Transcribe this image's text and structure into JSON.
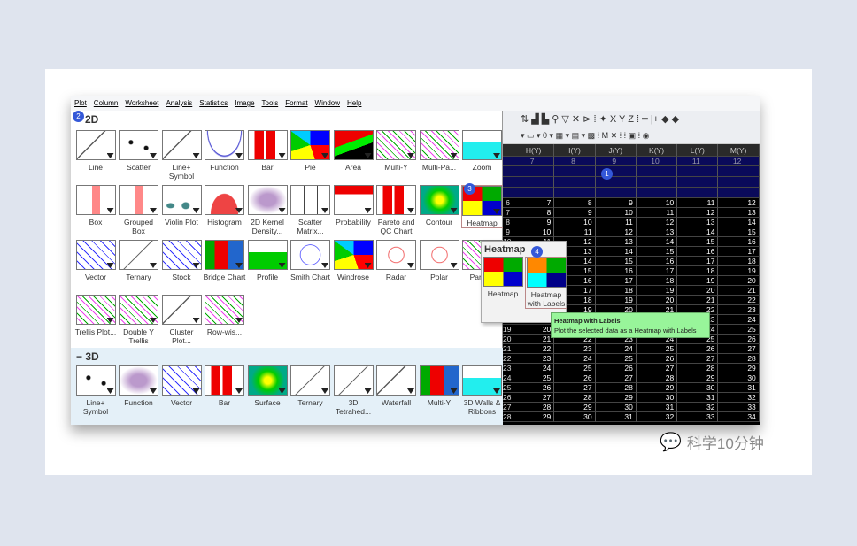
{
  "menubar": [
    "Plot",
    "Column",
    "Worksheet",
    "Analysis",
    "Statistics",
    "Image",
    "Tools",
    "Format",
    "Window",
    "Help"
  ],
  "section_2d": "2D",
  "section_3d": "− 3D",
  "rows2d": [
    [
      {
        "label": "Line",
        "icon": "line"
      },
      {
        "label": "Scatter",
        "icon": "scatter"
      },
      {
        "label": "Line+ Symbol",
        "icon": "line"
      },
      {
        "label": "Function",
        "icon": "function"
      },
      {
        "label": "Bar",
        "icon": "bar"
      },
      {
        "label": "Pie",
        "icon": "pie"
      },
      {
        "label": "Area",
        "icon": "area"
      },
      {
        "label": "Multi-Y",
        "icon": "multi"
      },
      {
        "label": "Multi-Pa...",
        "icon": "multi"
      },
      {
        "label": "Zoom",
        "icon": "zoom"
      }
    ],
    [
      {
        "label": "Box",
        "icon": "box"
      },
      {
        "label": "Grouped Box",
        "icon": "box"
      },
      {
        "label": "Violin Plot",
        "icon": "violin"
      },
      {
        "label": "Histogram",
        "icon": "hist"
      },
      {
        "label": "2D Kernel Density...",
        "icon": "kernel"
      },
      {
        "label": "Scatter Matrix...",
        "icon": "matrix"
      },
      {
        "label": "Probability",
        "icon": "prob"
      },
      {
        "label": "Pareto and QC Chart",
        "icon": "bar"
      },
      {
        "label": "Contour",
        "icon": "contour"
      },
      {
        "label": "Heatmap",
        "icon": "heatmap"
      }
    ],
    [
      {
        "label": "Vector",
        "icon": "vector"
      },
      {
        "label": "Ternary",
        "icon": "ternary"
      },
      {
        "label": "Stock",
        "icon": "vector"
      },
      {
        "label": "Bridge Chart",
        "icon": "bridge"
      },
      {
        "label": "Profile",
        "icon": "profile"
      },
      {
        "label": "Smith Chart",
        "icon": "smith"
      },
      {
        "label": "Windrose",
        "icon": "pie"
      },
      {
        "label": "Radar",
        "icon": "radar"
      },
      {
        "label": "Polar",
        "icon": "radar"
      },
      {
        "label": "Para Pl",
        "icon": "multi"
      }
    ],
    [
      {
        "label": "Trellis Plot...",
        "icon": "multi"
      },
      {
        "label": "Double Y Trellis",
        "icon": "multi"
      },
      {
        "label": "Cluster Plot...",
        "icon": "line"
      },
      {
        "label": "Row-wis...",
        "icon": "multi"
      }
    ]
  ],
  "row3d": [
    {
      "label": "Line+ Symbol",
      "icon": "scatter"
    },
    {
      "label": "Function",
      "icon": "kernel"
    },
    {
      "label": "Vector",
      "icon": "vector"
    },
    {
      "label": "Bar",
      "icon": "bar"
    },
    {
      "label": "Surface",
      "icon": "contour"
    },
    {
      "label": "Ternary",
      "icon": "ternary"
    },
    {
      "label": "3D Tetrahed...",
      "icon": "ternary"
    },
    {
      "label": "Waterfall",
      "icon": "line"
    },
    {
      "label": "Multi-Y",
      "icon": "bridge"
    },
    {
      "label": "3D Walls & Ribbons",
      "icon": "zoom"
    }
  ],
  "toolbar1": "⇅ ▟ ▙ ⚲ ▽ ✕ ⊳ ⁞ ✦ X Y Z ⁞ ━ |+ ◆ ◆",
  "toolbar2": "▾ ▭ ▾ 0 ▾ ▦ ▾ ▤ ▾ ▩ ⁞ M ✕ ⁞ ⁞ ▣ ⁞ ◉",
  "grid": {
    "columns": [
      "H(Y)",
      "I(Y)",
      "J(Y)",
      "K(Y)",
      "L(Y)",
      "M(Y)"
    ],
    "header_values": [
      "7",
      "8",
      "9",
      "10",
      "11",
      "12"
    ],
    "rows": [
      [
        6,
        7,
        8,
        9,
        10,
        11,
        12
      ],
      [
        7,
        8,
        9,
        10,
        11,
        12,
        13
      ],
      [
        8,
        9,
        10,
        11,
        12,
        13,
        14
      ],
      [
        9,
        10,
        11,
        12,
        13,
        14,
        15
      ],
      [
        10,
        11,
        12,
        13,
        14,
        15,
        16
      ],
      [
        11,
        12,
        13,
        14,
        15,
        16,
        17
      ],
      [
        12,
        13,
        14,
        15,
        16,
        17,
        18
      ],
      [
        13,
        14,
        15,
        16,
        17,
        18,
        19
      ],
      [
        14,
        15,
        16,
        17,
        18,
        19,
        20
      ],
      [
        15,
        16,
        17,
        18,
        19,
        20,
        21
      ],
      [
        16,
        17,
        18,
        19,
        20,
        21,
        22
      ],
      [
        17,
        18,
        19,
        20,
        21,
        22,
        23
      ],
      [
        18,
        19,
        20,
        21,
        22,
        23,
        24
      ],
      [
        19,
        20,
        21,
        22,
        23,
        24,
        25
      ],
      [
        20,
        21,
        22,
        23,
        24,
        25,
        26
      ],
      [
        21,
        22,
        23,
        24,
        25,
        26,
        27
      ],
      [
        22,
        23,
        24,
        25,
        26,
        27,
        28
      ],
      [
        23,
        24,
        25,
        26,
        27,
        28,
        29
      ],
      [
        24,
        25,
        26,
        27,
        28,
        29,
        30
      ],
      [
        25,
        26,
        27,
        28,
        29,
        30,
        31
      ],
      [
        26,
        27,
        28,
        29,
        30,
        31,
        32
      ],
      [
        27,
        28,
        29,
        30,
        31,
        32,
        33
      ],
      [
        28,
        29,
        30,
        31,
        32,
        33,
        34
      ]
    ]
  },
  "submenu": {
    "title": "Heatmap",
    "items": [
      {
        "label": "Heatmap"
      },
      {
        "label": "Heatmap with Labels"
      }
    ]
  },
  "tooltip": {
    "title": "Heatmap with Labels",
    "text": "Plot the selected data as a Heatmap with Labels"
  },
  "badges": [
    "1",
    "2",
    "3",
    "4"
  ],
  "watermark": "科学10分钟"
}
